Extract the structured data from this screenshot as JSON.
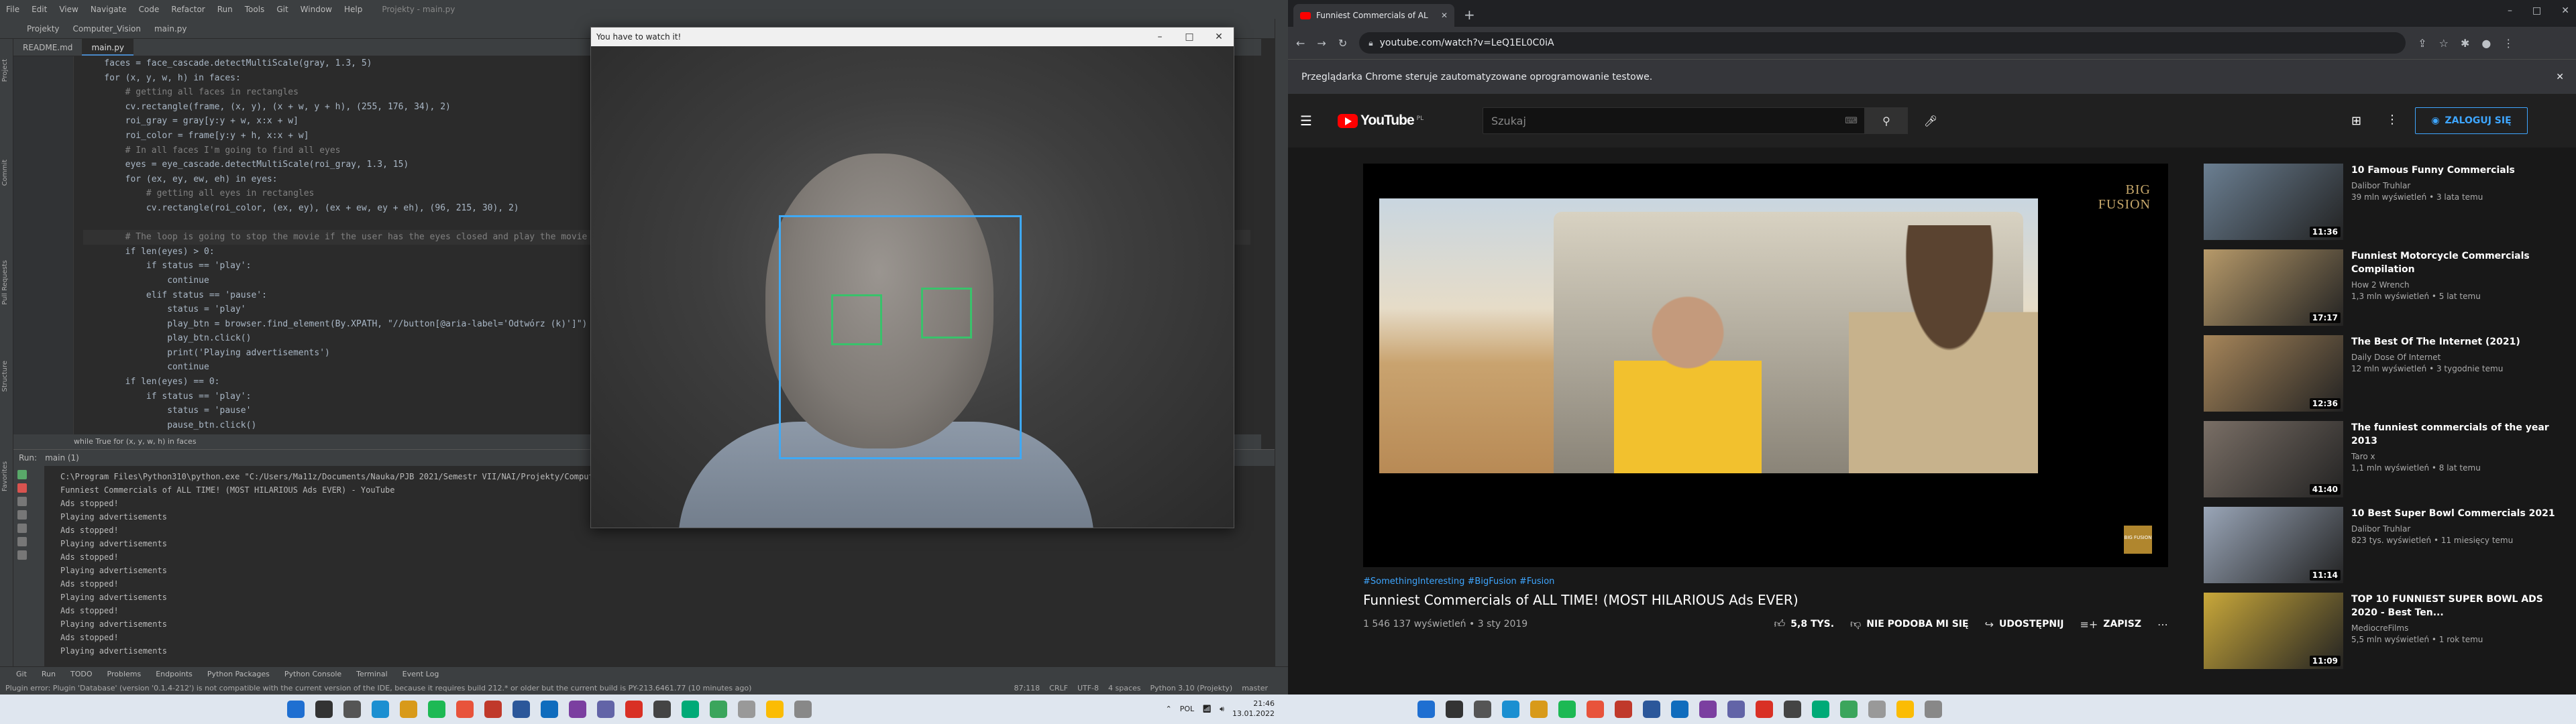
{
  "ide": {
    "menu": [
      "File",
      "Edit",
      "View",
      "Navigate",
      "Code",
      "Refactor",
      "Run",
      "Tools",
      "Git",
      "Window",
      "Help"
    ],
    "window_title": "Projekty - main.py",
    "nav": [
      "Projekty",
      "Computer_Vision",
      "main.py"
    ],
    "rail_labels": [
      "Project",
      "Commit",
      "Pull Requests",
      "Structure",
      "Favorites"
    ],
    "tabs": [
      "README.md",
      "main.py"
    ],
    "code_lines": [
      {
        "t": "    faces = face_cascade.detectMultiScale(gray, 1.3, 5)",
        "c": ""
      },
      {
        "t": "    for (x, y, w, h) in faces:",
        "c": ""
      },
      {
        "t": "        # getting all faces in rectangles",
        "c": "cm"
      },
      {
        "t": "        cv.rectangle(frame, (x, y), (x + w, y + h), (255, 176, 34), 2)",
        "c": ""
      },
      {
        "t": "        roi_gray = gray[y:y + w, x:x + w]",
        "c": ""
      },
      {
        "t": "        roi_color = frame[y:y + h, x:x + w]",
        "c": ""
      },
      {
        "t": "        # In all faces I'm going to find all eyes",
        "c": "cm"
      },
      {
        "t": "        eyes = eye_cascade.detectMultiScale(roi_gray, 1.3, 15)",
        "c": ""
      },
      {
        "t": "        for (ex, ey, ew, eh) in eyes:",
        "c": ""
      },
      {
        "t": "            # getting all eyes in rectangles",
        "c": "cm"
      },
      {
        "t": "            cv.rectangle(roi_color, (ex, ey), (ex + ew, ey + eh), (96, 215, 30), 2)",
        "c": ""
      },
      {
        "t": "",
        "c": ""
      },
      {
        "t": "        # The loop is going to stop the movie if the user has the eyes closed and play the movie i",
        "c": "cm hl"
      },
      {
        "t": "        if len(eyes) > 0:",
        "c": ""
      },
      {
        "t": "            if status == 'play':",
        "c": ""
      },
      {
        "t": "                continue",
        "c": ""
      },
      {
        "t": "            elif status == 'pause':",
        "c": ""
      },
      {
        "t": "                status = 'play'",
        "c": ""
      },
      {
        "t": "                play_btn = browser.find_element(By.XPATH, \"//button[@aria-label='Odtwórz (k)']\")",
        "c": ""
      },
      {
        "t": "                play_btn.click()",
        "c": ""
      },
      {
        "t": "                print('Playing advertisements')",
        "c": ""
      },
      {
        "t": "                continue",
        "c": ""
      },
      {
        "t": "        if len(eyes) == 0:",
        "c": ""
      },
      {
        "t": "            if status == 'play':",
        "c": ""
      },
      {
        "t": "                status = 'pause'",
        "c": ""
      },
      {
        "t": "                pause_btn.click()",
        "c": ""
      }
    ],
    "breadcrumb": "while True    for (x, y, w, h) in faces",
    "run_header": [
      "Run:",
      "main (1)"
    ],
    "console": [
      "C:\\Program Files\\Python310\\python.exe \"C:/Users/Ma11z/Documents/Nauka/PJB 2021/Semestr VII/NAI/Projekty/Computer_Vision/main.py\"",
      "Funniest Commercials of ALL TIME! (MOST HILARIOUS Ads EVER) - YouTube",
      "Ads stopped!",
      "Playing advertisements",
      "Ads stopped!",
      "Playing advertisements",
      "Ads stopped!",
      "Playing advertisements",
      "Ads stopped!",
      "Playing advertisements",
      "Ads stopped!",
      "Playing advertisements",
      "Ads stopped!",
      "Playing advertisements"
    ],
    "bottom_tabs": [
      "Git",
      "Run",
      "TODO",
      "Problems",
      "Endpoints",
      "Python Packages",
      "Python Console",
      "Terminal",
      "Event Log"
    ],
    "status_left": "Plugin error: Plugin 'Database' (version '0.1.4-212') is not compatible with the current version of the IDE, because it requires build 212.* or older but the current build is PY-213.6461.77 (10 minutes ago)",
    "status_right": [
      "87:118",
      "CRLF",
      "UTF-8",
      "4 spaces",
      "Python 3.10 (Projekty)",
      "master"
    ]
  },
  "camera": {
    "title": "You have to watch it!"
  },
  "chrome": {
    "tab_title": "Funniest Commercials of AL",
    "url": "youtube.com/watch?v=LeQ1EL0C0iA",
    "infobar": "Przeglądarka Chrome steruje zautomatyzowane oprogramowanie testowe."
  },
  "youtube": {
    "logo": "YouTube",
    "region": "PL",
    "search_placeholder": "Szukaj",
    "signin": "ZALOGUJ SIĘ",
    "video_watermark_line1": "BIG",
    "video_watermark_line2": "FUSION",
    "badge": "BIG FUSION",
    "hashtags": "#SomethingInteresting #BigFusion #Fusion",
    "title": "Funniest Commercials of ALL TIME! (MOST HILARIOUS Ads EVER)",
    "meta": "1 546 137 wyświetleń • 3 sty 2019",
    "likes": "5,8 TYS.",
    "dislike": "NIE PODOBA MI SIĘ",
    "share": "UDOSTĘPNIJ",
    "save": "ZAPISZ",
    "related": [
      {
        "title": "10 Famous Funny Commercials",
        "channel": "Dalibor Truhlar",
        "stats": "39 mln wyświetleń • 3 lata temu",
        "duration": "11:36",
        "color": "#6b7f92"
      },
      {
        "title": "Funniest Motorcycle Commercials Compilation",
        "channel": "How 2 Wrench",
        "stats": "1,3 mln wyświetleń • 5 lat temu",
        "duration": "17:17",
        "color": "#b79a6a"
      },
      {
        "title": "The Best Of The Internet (2021)",
        "channel": "Daily Dose Of Internet",
        "stats": "12 mln wyświetleń • 3 tygodnie temu",
        "duration": "12:36",
        "color": "#a7865a"
      },
      {
        "title": "The funniest commercials of the year 2013",
        "channel": "Taro x",
        "stats": "1,1 mln wyświetleń • 8 lat temu",
        "duration": "41:40",
        "color": "#7a6f66"
      },
      {
        "title": "10 Best Super Bowl Commercials 2021",
        "channel": "Dalibor Truhlar",
        "stats": "823 tys. wyświetleń • 11 miesięcy temu",
        "duration": "11:14",
        "color": "#9aa6b8"
      },
      {
        "title": "TOP 10 FUNNIEST SUPER BOWL ADS 2020 - Best Ten...",
        "channel": "MediocreFilms",
        "stats": "5,5 mln wyświetleń • 1 rok temu",
        "duration": "11:09",
        "color": "#c9a83a"
      }
    ]
  },
  "taskbar": {
    "clock_time": "21:46",
    "clock_date": "13.01.2022",
    "lang": "POL",
    "icon_colors": [
      "#1f6fd1",
      "#333",
      "#555",
      "#1b8fd1",
      "#d89a1a",
      "#1db954",
      "#e8533b",
      "#c0392b",
      "#2b579a",
      "#0f6cbd",
      "#7b3fa0",
      "#6264a7",
      "#d93025",
      "#444",
      "#0a7",
      "#3ba55c",
      "#999",
      "#fbbc04",
      "#888"
    ]
  }
}
